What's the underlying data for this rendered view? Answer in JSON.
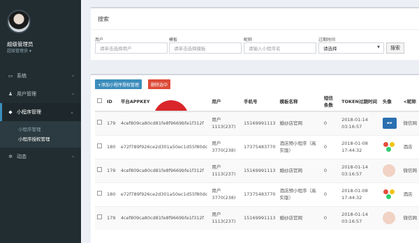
{
  "sidebar": {
    "user_name": "超级管理员",
    "user_role": "超级管理员 ▾",
    "menu": [
      {
        "icon": "monitor-icon",
        "glyph": "▭",
        "label": "系统"
      },
      {
        "icon": "users-icon",
        "glyph": "♟",
        "label": "用户管理"
      },
      {
        "icon": "chat-icon",
        "glyph": "◆",
        "label": "小程序管理"
      },
      {
        "icon": "share-icon",
        "glyph": "✲",
        "label": "动态"
      }
    ],
    "submenu": [
      "小程序管理",
      "小程序授权管理"
    ]
  },
  "search": {
    "title": "搜索",
    "fields": [
      {
        "label": "用户",
        "placeholder": "请单击选择用户"
      },
      {
        "label": "模板",
        "placeholder": "请单击选择模板"
      },
      {
        "label": "昵称",
        "placeholder": "请输入小程序名"
      },
      {
        "label": "过期时间",
        "value": "请选择"
      }
    ],
    "button": "搜索"
  },
  "table": {
    "add_button": "+添加小程序授权管理",
    "delete_button": "删除选中",
    "headers": [
      "",
      "ID",
      "平台APPKEY",
      "用户",
      "手机号",
      "模板名称",
      "短信条数",
      "TOKEN过期时间",
      "头像",
      "<昵称"
    ],
    "rows": [
      {
        "id": "179",
        "appkey": "4cef809ca80cd81fe8f9669bfe1f312f",
        "user": "用户1113(237)",
        "phone": "15169991113",
        "template": "婚纱店官网",
        "sms": "0",
        "expire": "2018-01-14 03:16:57",
        "avatar": "car",
        "nick": "微信网"
      },
      {
        "id": "180",
        "appkey": "e72f789f926ce2d301a50ec1d55f80dc",
        "user": "用户3770(238)",
        "phone": "17375483770",
        "template": "酒店预小程序（高实版）",
        "sms": "0",
        "expire": "2018-01-08 17:44:32",
        "avatar": "dots",
        "nick": "酒店"
      },
      {
        "id": "179",
        "appkey": "4cef809ca80cd81fe8f9669bfe1f312f",
        "user": "用户1113(237)",
        "phone": "15169991113",
        "template": "婚纱店官网",
        "sms": "0",
        "expire": "2018-01-14 03:16:57",
        "avatar": "cake",
        "nick": "微信网"
      },
      {
        "id": "180",
        "appkey": "e72f789f926ce2d301a50ec1d55f80dc",
        "user": "用户3770(238)",
        "phone": "17375483770",
        "template": "酒店预小程序（高实版）",
        "sms": "0",
        "expire": "2018-01-08 17:44:32",
        "avatar": "dots",
        "nick": "酒店"
      },
      {
        "id": "179",
        "appkey": "4cef809ca80cd81fe8f9669bfe1f312f",
        "user": "用户1113(237)",
        "phone": "15169991113",
        "template": "婚纱店官网",
        "sms": "0",
        "expire": "2018-01-14 03:16:57",
        "avatar": "cake",
        "nick": "微信网"
      }
    ]
  },
  "colors": {
    "sidebar": "#222d32",
    "primary": "#3c8dbc",
    "danger": "#dd4b39"
  }
}
